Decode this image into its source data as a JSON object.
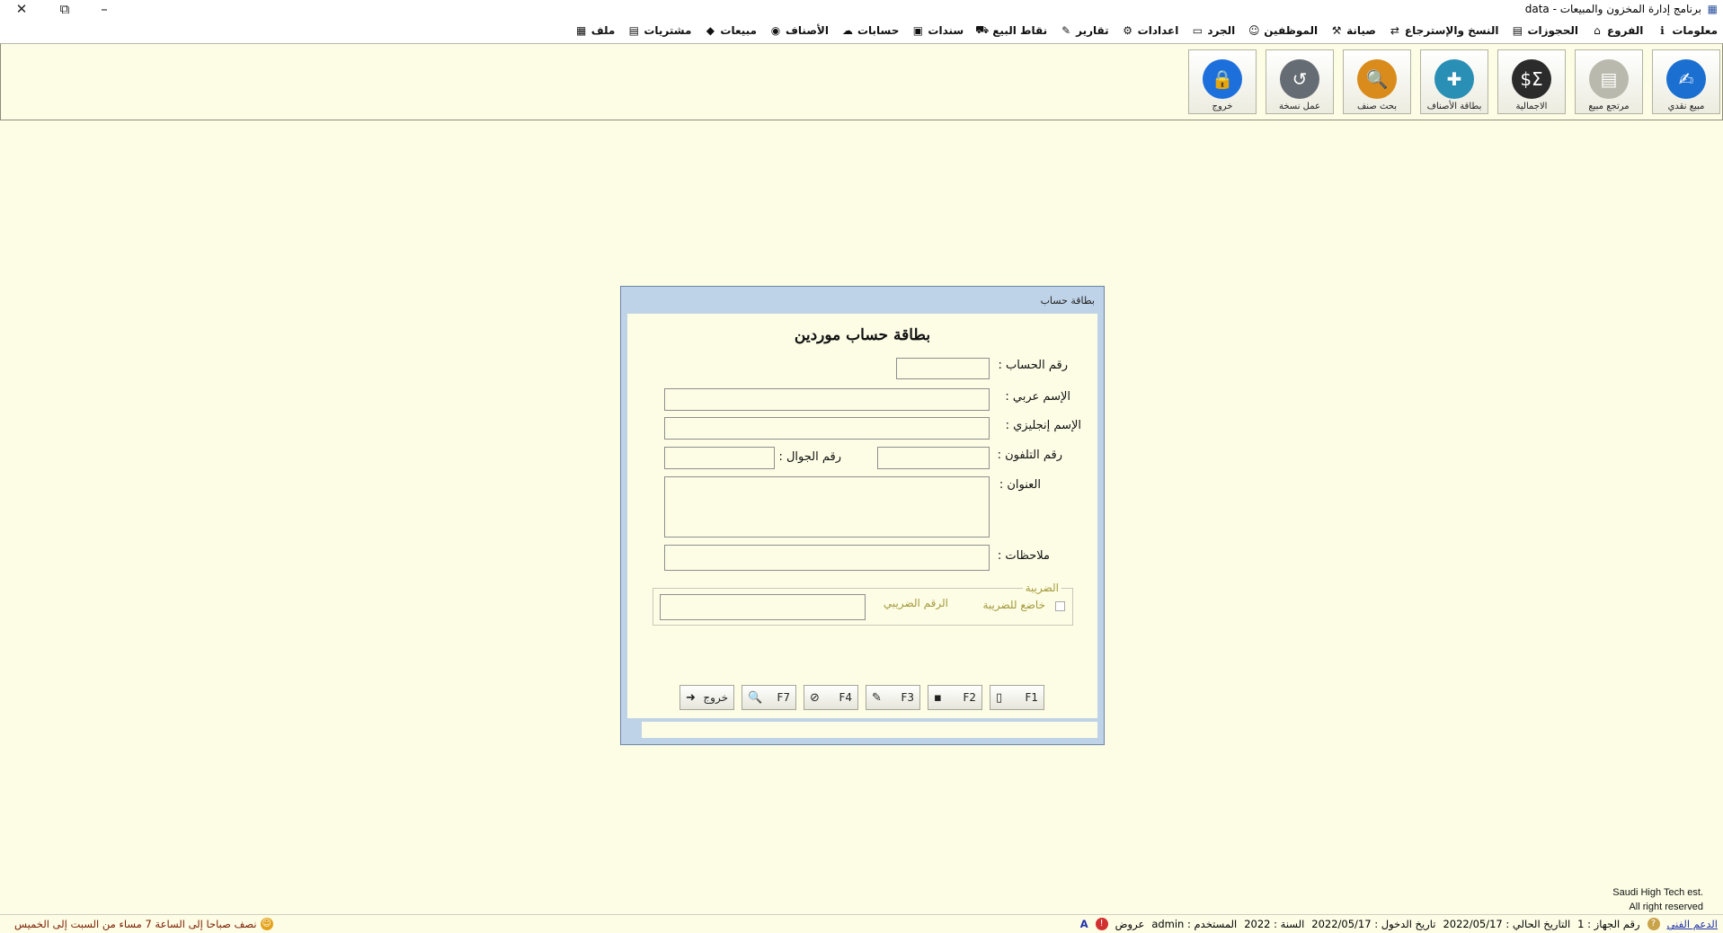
{
  "window": {
    "title": "برنامج إدارة المخزون والمبيعات  - data",
    "close_glyph": "✕",
    "restore_glyph": "⧉",
    "minimize_glyph": "–"
  },
  "menu": [
    {
      "label": "ملف",
      "icon": "grid-icon",
      "glyph": "▦"
    },
    {
      "label": "مشتريات",
      "icon": "document-icon",
      "glyph": "▤"
    },
    {
      "label": "مبيعات",
      "icon": "bag-icon",
      "glyph": "◆"
    },
    {
      "label": "الأصناف",
      "icon": "bottle-icon",
      "glyph": "◉"
    },
    {
      "label": "حسابات",
      "icon": "cloud-icon",
      "glyph": "☁"
    },
    {
      "label": "سندات",
      "icon": "printer-icon",
      "glyph": "▣"
    },
    {
      "label": "نقاط البيع",
      "icon": "cart-icon",
      "glyph": "⛟"
    },
    {
      "label": "تقارير",
      "icon": "report-icon",
      "glyph": "✎"
    },
    {
      "label": "اعدادات",
      "icon": "settings-icon",
      "glyph": "⚙"
    },
    {
      "label": "الجرد",
      "icon": "box-icon",
      "glyph": "▭"
    },
    {
      "label": "الموظفين",
      "icon": "employee-icon",
      "glyph": "☺"
    },
    {
      "label": "صيانة",
      "icon": "wrench-icon",
      "glyph": "⚒"
    },
    {
      "label": "النسخ والإسترجاع",
      "icon": "backup-icon",
      "glyph": "⇄"
    },
    {
      "label": "الحجوزات",
      "icon": "reservation-icon",
      "glyph": "▤"
    },
    {
      "label": "الفروع",
      "icon": "branches-icon",
      "glyph": "⌂"
    },
    {
      "label": "معلومات",
      "icon": "info-icon",
      "glyph": "ℹ"
    }
  ],
  "toolbar": [
    {
      "label": "مبيع نقدي",
      "icon": "cash-sale-icon",
      "glyph": "✍",
      "color": "#1a6fd0"
    },
    {
      "label": "مرتجع مبيع",
      "icon": "sale-return-icon",
      "glyph": "▤",
      "color": "#b9b9ad"
    },
    {
      "label": "الاجمالية",
      "icon": "totals-icon",
      "glyph": "$Σ",
      "color": "#2b2b2b"
    },
    {
      "label": "بطاقة الأصناف",
      "icon": "item-card-icon",
      "glyph": "✚",
      "color": "#2a8fb5"
    },
    {
      "label": "بحث صنف",
      "icon": "item-search-icon",
      "glyph": "🔍",
      "color": "#d98c1c"
    },
    {
      "label": "عمل نسخة",
      "icon": "backup-clock-icon",
      "glyph": "↺",
      "color": "#666c74"
    },
    {
      "label": "خروج",
      "icon": "lock-icon",
      "glyph": "🔒",
      "color": "#1d6fdc"
    }
  ],
  "dialog": {
    "title": "بطاقة حساب",
    "heading": "بطاقة حساب موردين",
    "fields": {
      "account_no_label": "رقم الحساب :",
      "account_no_value": "",
      "arabic_name_label": "الإسم عربي :",
      "arabic_name_value": "",
      "english_name_label": "الإسم إنجليزي :",
      "english_name_value": "",
      "phone_label": "رقم التلفون :",
      "phone_value": "",
      "mobile_label": "رقم الجوال :",
      "mobile_value": "",
      "address_label": "العنوان :",
      "address_value": "",
      "notes_label": "ملاحظات :",
      "notes_value": ""
    },
    "tax": {
      "legend": "الضريبة",
      "subject_label": "خاضع للضريبة",
      "subject_checked": false,
      "tax_no_label": "الرقم الضريبي",
      "tax_no_value": ""
    },
    "buttons": [
      {
        "label": "F1",
        "icon": "new-document-icon",
        "glyph": "▯"
      },
      {
        "label": "F2",
        "icon": "save-icon",
        "glyph": "▪"
      },
      {
        "label": "F3",
        "icon": "edit-icon",
        "glyph": "✎"
      },
      {
        "label": "F4",
        "icon": "delete-icon",
        "glyph": "⊘"
      },
      {
        "label": "F7",
        "icon": "search-icon",
        "glyph": "🔍"
      },
      {
        "label": "خروج",
        "icon": "exit-icon",
        "glyph": "➜"
      }
    ]
  },
  "watermark": {
    "line1": "Saudi High Tech est.",
    "line2": "All right reserved"
  },
  "status": {
    "users_prefix": "A",
    "offers": "عروض",
    "user_label": "المستخدم :",
    "user_value": "admin",
    "year_label": "السنة :",
    "year_value": "2022",
    "login_label": "تاريخ الدخول :",
    "login_value": "2022/05/17",
    "current_label": "التاريخ الحالي :",
    "current_value": "2022/05/17",
    "device_label": "رقم الجهاز :",
    "device_value": "1",
    "support": "الدعم الفني",
    "hours": "نصف صباحا إلى الساعة 7 مساء من السبت إلى الخميس"
  }
}
